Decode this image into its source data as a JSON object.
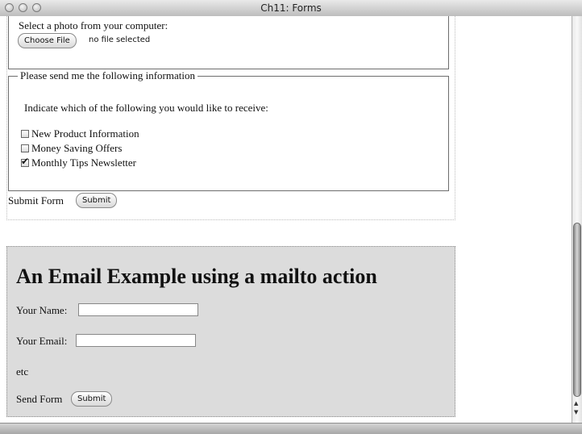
{
  "window": {
    "title": "Ch11: Forms"
  },
  "upload": {
    "label": "Select a photo from your computer:",
    "button_label": "Choose File",
    "status": "no file selected"
  },
  "info": {
    "legend": "Please send me the following information",
    "prompt": "Indicate which of the following you would like to receive:",
    "options": [
      {
        "label": "New Product Information",
        "checked": false
      },
      {
        "label": "Money Saving Offers",
        "checked": false
      },
      {
        "label": "Monthly Tips Newsletter",
        "checked": true
      }
    ]
  },
  "submit": {
    "label": "Submit Form",
    "button_label": "Submit"
  },
  "mailto": {
    "heading": "An Email Example using a mailto action",
    "name_label": "Your Name:",
    "name_value": "",
    "email_label": "Your Email:",
    "email_value": "",
    "etc": "etc",
    "send_label": "Send Form",
    "send_button_label": "Submit"
  },
  "colors": {
    "mailto_bg": "#dcdcdc"
  }
}
